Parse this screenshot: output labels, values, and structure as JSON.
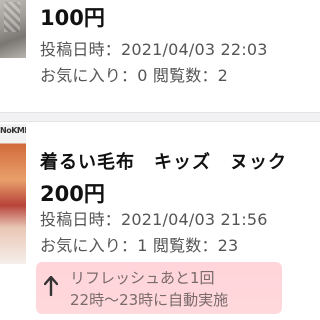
{
  "items": [
    {
      "price": "100円",
      "posted": "投稿日時：2021/04/03 22:03",
      "stats": "お気に入り：0 閲覧数：2"
    },
    {
      "brand": "NoKME",
      "title": "着るい毛布　キッズ　ヌック",
      "price": "200円",
      "posted": "投稿日時：2021/04/03 21:56",
      "stats": "お気に入り：1 閲覧数：23",
      "refresh": {
        "line1": "リフレッシュあと1回",
        "line2": "22時〜23時に自動実施"
      }
    }
  ],
  "icons": {
    "refresh": "arrow-up-icon"
  },
  "colors": {
    "highlight": "#ffc6cd",
    "text_muted": "#555555"
  }
}
